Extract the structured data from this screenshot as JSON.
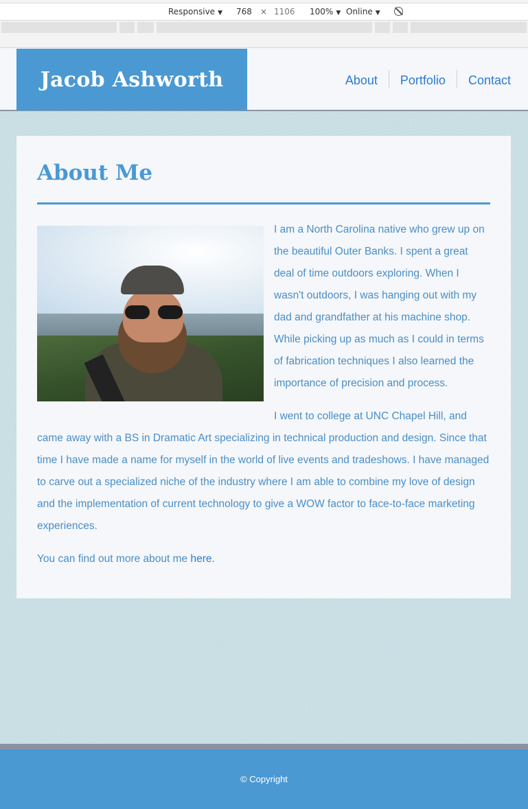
{
  "devtools": {
    "device": "Responsive",
    "width": "768",
    "times": "×",
    "height": "1106",
    "zoom": "100%",
    "network": "Online",
    "rotate_icon": "rotate-disabled-icon"
  },
  "header": {
    "brand": "Jacob Ashworth",
    "nav": [
      "About",
      "Portfolio",
      "Contact"
    ]
  },
  "main": {
    "title": "About Me",
    "photo_alt": "Selfie of a bearded man in a cap and sunglasses above a fjord",
    "paragraph1": "I am a North Carolina native who grew up on the beautiful Outer Banks. I spent a great deal of time outdoors exploring. When I wasn't outdoors, I was hanging out with my dad and grandfather at his machine shop. While picking up as much as I could in terms of fabrication techniques I also learned the importance of precision and process.",
    "paragraph2": "I went to college at UNC Chapel Hill, and came away with a BS in Dramatic Art specializing in technical production and design. Since that time I have made a name for myself in the world of live events and tradeshows. I have managed to carve out a specialized niche of the industry where I am able to combine my love of design and the implementation of current technology to give a WOW factor to face-to-face marketing experiences.",
    "more_text": "You can find out more about me ",
    "more_link": "here."
  },
  "footer": {
    "copyright": "© Copyright"
  },
  "colors": {
    "accent": "#4a99d3",
    "link": "#2c7ad1",
    "background": "#c8dfe5",
    "card": "#f5f7fa",
    "divider": "#8b93a3"
  }
}
